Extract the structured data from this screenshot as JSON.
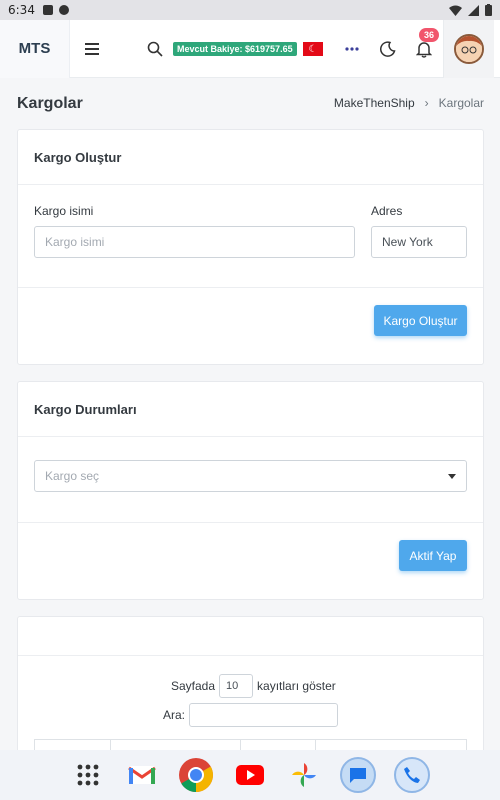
{
  "status_bar": {
    "time": "6:34"
  },
  "nav": {
    "brand": "MTS",
    "balance": "Mevcut Bakiye: $619757.65",
    "notification_count": "36"
  },
  "page": {
    "title": "Kargolar",
    "breadcrumb": [
      "MakeThenShip",
      "Kargolar"
    ]
  },
  "create_card": {
    "title": "Kargo Oluştur",
    "name_label": "Kargo isimi",
    "name_placeholder": "Kargo isimi",
    "name_value": "",
    "address_label": "Adres",
    "address_value": "New York",
    "submit_label": "Kargo Oluştur"
  },
  "status_card": {
    "title": "Kargo Durumları",
    "select_placeholder": "Kargo seç",
    "activate_label": "Aktif Yap"
  },
  "table_card": {
    "per_page_prefix": "Sayfada",
    "per_page_value": "10",
    "per_page_suffix": "kayıtları göster",
    "search_label": "Ara:"
  },
  "taskbar": {
    "apps": [
      "app-drawer-icon",
      "gmail-icon",
      "chrome-icon",
      "youtube-icon",
      "photos-icon",
      "messages-icon",
      "phone-icon"
    ]
  },
  "colors": {
    "accent": "#4fa8ec",
    "balance_bg": "#2ea77a",
    "badge": "#f1556c"
  }
}
